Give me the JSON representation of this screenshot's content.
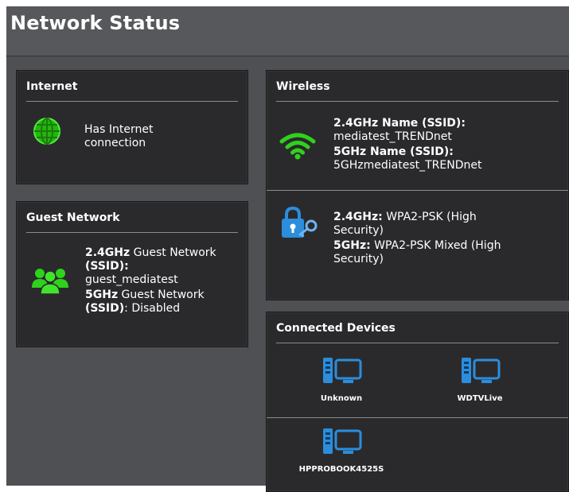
{
  "page": {
    "title": "Network Status"
  },
  "internet": {
    "title": "Internet",
    "status_line1": "Has Internet",
    "status_line2": "connection",
    "icon": "globe-icon"
  },
  "guest": {
    "title": "Guest Network",
    "l1_bold": "2.4GHz",
    "l1_rest": " Guest Network",
    "l2_bold": "(SSID):",
    "l3": "guest_mediatest",
    "l4_bold": "5GHz",
    "l4_rest": " Guest Network",
    "l5_bold": "(SSID)",
    "l5_rest": ": Disabled",
    "icon": "users-icon"
  },
  "wireless": {
    "title": "Wireless",
    "ssid24_label": "2.4GHz Name (SSID):",
    "ssid24_value": "mediatest_TRENDnet",
    "ssid5_label": "5GHz Name (SSID):",
    "ssid5_value": "5GHzmediatest_TRENDnet",
    "sec24_label": "2.4GHz:",
    "sec24_value_a": " WPA2-PSK (High",
    "sec24_value_b": "Security)",
    "sec5_label": "5GHz:",
    "sec5_value_a": " WPA2-PSK Mixed (High",
    "sec5_value_b": "Security)",
    "wifi_icon": "wifi-icon",
    "lock_icon": "lock-key-icon"
  },
  "devices": {
    "title": "Connected Devices",
    "items": [
      {
        "name": "Unknown"
      },
      {
        "name": "WDTVLive"
      },
      {
        "name": "HPPROBOOK4525S"
      }
    ],
    "icon": "computer-icon"
  },
  "colors": {
    "background": "#4e5053",
    "panel": "#2a2a2c",
    "accent_green": "#2fd11c",
    "device_blue": "#2c8ddc"
  }
}
